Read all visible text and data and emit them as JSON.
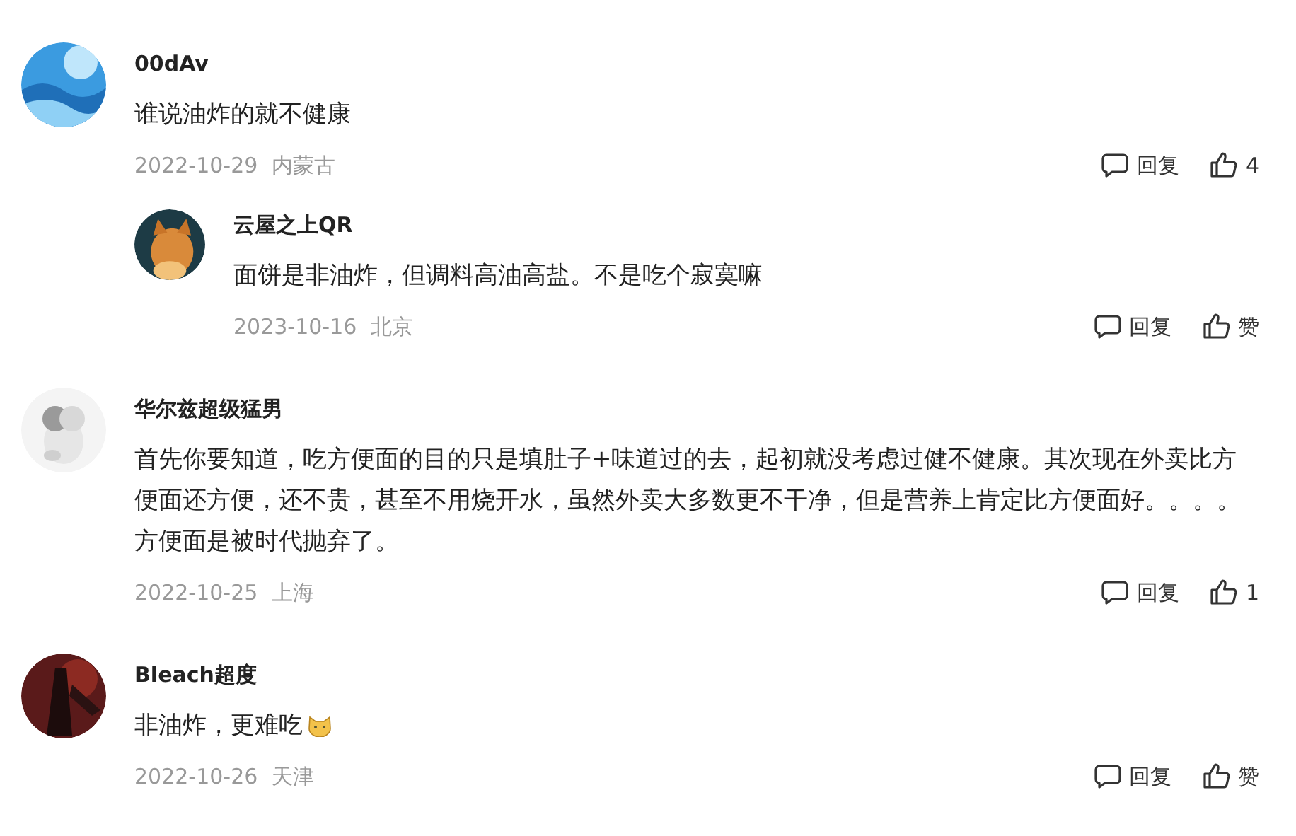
{
  "comments": [
    {
      "author": "00dAv",
      "text": "谁说油炸的就不健康",
      "date": "2022-10-29",
      "location": "内蒙古",
      "reply_label": "回复",
      "likes": "4",
      "replies": [
        {
          "author": "云屋之上QR",
          "text": "面饼是非油炸，但调料高油高盐。不是吃个寂寞嘛",
          "date": "2023-10-16",
          "location": "北京",
          "reply_label": "回复",
          "likes": "赞"
        }
      ]
    },
    {
      "author": "华尔兹超级猛男",
      "text": "首先你要知道，吃方便面的目的只是填肚子+味道过的去，起初就没考虑过健不健康。其次现在外卖比方便面还方便，还不贵，甚至不用烧开水，虽然外卖大多数更不干净，但是营养上肯定比方便面好。。。。方便面是被时代抛弃了。",
      "date": "2022-10-25",
      "location": "上海",
      "reply_label": "回复",
      "likes": "1"
    },
    {
      "author": "Bleach超度",
      "text": "非油炸，更难吃",
      "emoji": true,
      "date": "2022-10-26",
      "location": "天津",
      "reply_label": "回复",
      "likes": "赞"
    }
  ]
}
